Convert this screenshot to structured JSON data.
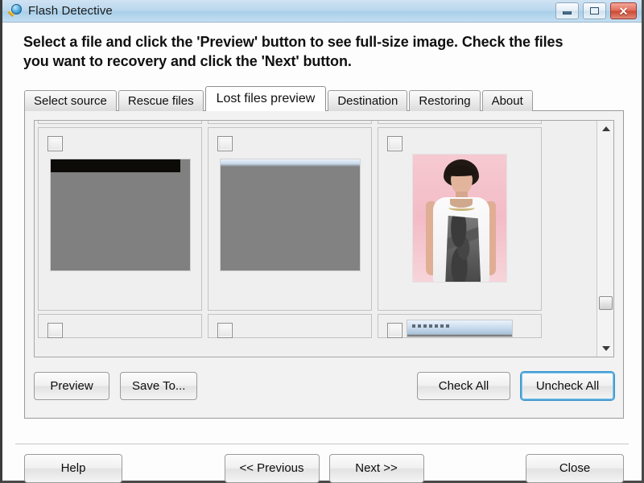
{
  "window": {
    "title": "Flash Detective",
    "icon": "magnifier-icon",
    "controls": {
      "minimize_label": "–",
      "maximize_label": "□",
      "close_label": "✕"
    }
  },
  "instructions": {
    "line1": "Select a file and click the 'Preview' button to see full-size image. Check the files",
    "line2": "you want to recovery and click the 'Next' button."
  },
  "tabs": [
    {
      "label": "Select source",
      "active": false
    },
    {
      "label": "Rescue files",
      "active": false
    },
    {
      "label": "Lost files preview",
      "active": true
    },
    {
      "label": "Destination",
      "active": false
    },
    {
      "label": "Restoring",
      "active": false
    },
    {
      "label": "About",
      "active": false
    }
  ],
  "file_grid": {
    "rows": [
      {
        "partial": true,
        "cells": [
          {
            "checked": false,
            "thumb": "partial"
          },
          {
            "checked": false,
            "thumb": "partial"
          },
          {
            "checked": false,
            "thumb": "partial"
          }
        ]
      },
      {
        "partial": false,
        "cells": [
          {
            "checked": false,
            "thumb": "screenshot-dark-band"
          },
          {
            "checked": false,
            "thumb": "screenshot-blue-band"
          },
          {
            "checked": false,
            "thumb": "portrait-photo-pink-background"
          }
        ]
      },
      {
        "partial": true,
        "cells": [
          {
            "checked": false,
            "thumb": "empty"
          },
          {
            "checked": false,
            "thumb": "empty"
          },
          {
            "checked": false,
            "thumb": "window-screenshot"
          }
        ]
      }
    ],
    "scrollbar": {
      "up_arrow": "scroll-up-arrow",
      "down_arrow": "scroll-down-arrow",
      "orientation": "vertical"
    }
  },
  "action_buttons": {
    "preview": "Preview",
    "save_to": "Save To...",
    "check_all": "Check All",
    "uncheck_all": "Uncheck All"
  },
  "nav_buttons": {
    "help": "Help",
    "previous": "<< Previous",
    "next": "Next >>",
    "close": "Close"
  },
  "colors": {
    "titlebar_blue": "#bcd8ee",
    "close_red": "#cc4a33",
    "focus_blue": "#4aa3d8",
    "panel_gray": "#f2f2f2",
    "photo_pink": "#f3bcc6"
  }
}
